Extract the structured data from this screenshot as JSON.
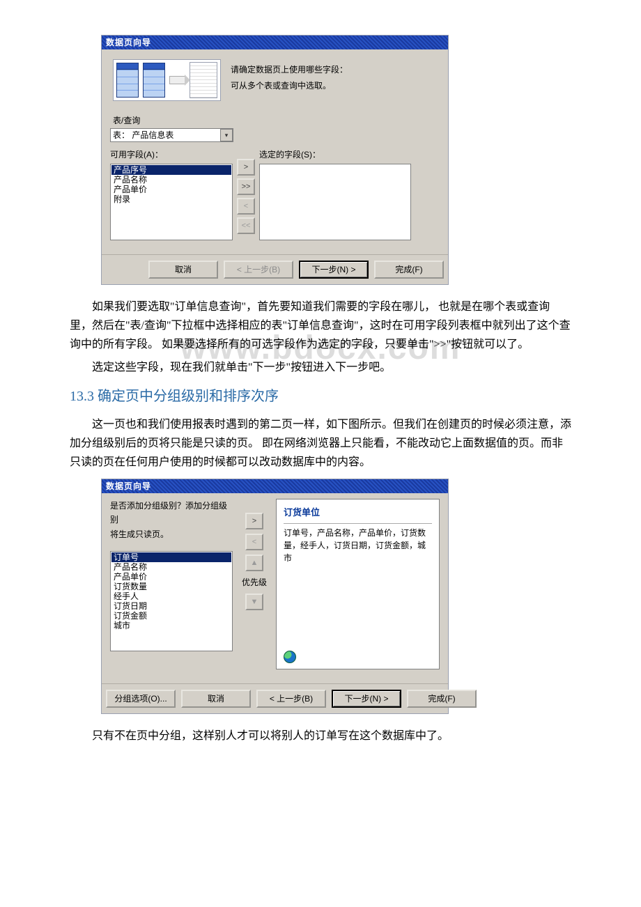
{
  "watermark": "www.bdocx.com",
  "dialog1": {
    "title": "数据页向导",
    "prompt_line1": "请确定数据页上使用哪些字段：",
    "prompt_line2": "可从多个表或查询中选取。",
    "table_query_label": "表/查询",
    "combo_value": "表： 产品信息表",
    "available_label": "可用字段(A)：",
    "selected_label": "选定的字段(S)：",
    "available_items": [
      "产品序号",
      "产品名称",
      "产品单价",
      "附录"
    ],
    "selected_index": 0,
    "btn_move_one": ">",
    "btn_move_all": ">>",
    "btn_back_one": "<",
    "btn_back_all": "<<",
    "cancel": "取消",
    "prev": "< 上一步(B)",
    "next": "下一步(N) >",
    "finish": "完成(F)"
  },
  "para1": "如果我们要选取\"订单信息查询\"，首先要知道我们需要的字段在哪儿， 也就是在哪个表或查询里，然后在\"表/查询\"下拉框中选择相应的表\"订单信息查询\"，这时在可用字段列表框中就列出了这个查询中的所有字段。 如果要选择所有的可选字段作为选定的字段，只要单击\">>\"按钮就可以了。",
  "para2": "选定这些字段，现在我们就单击\"下一步\"按钮进入下一步吧。",
  "section_title": "13.3 确定页中分组级别和排序次序",
  "para3": "这一页也和我们使用报表时遇到的第二页一样，如下图所示。但我们在创建页的时候必须注意，添加分组级别后的页将只能是只读的页。 即在网络浏览器上只能看，不能改动它上面数据值的页。而非只读的页在任何用户使用的时候都可以改动数据库中的内容。",
  "dialog2": {
    "title": "数据页向导",
    "prompt_line1": "是否添加分组级别？添加分组级别",
    "prompt_line2": "将生成只读页。",
    "list_items": [
      "订单号",
      "产品名称",
      "产品单价",
      "订货数量",
      "经手人",
      "订货日期",
      "订货金额",
      "城市"
    ],
    "selected_index": 0,
    "btn_add": ">",
    "btn_remove": "<",
    "priority_label": "优先级",
    "preview_title": "订货单位",
    "preview_body": "订单号，产品名称，产品单价，订货数量，经手人，订货日期，订货金额，城市",
    "group_options": "分组选项(O)...",
    "cancel": "取消",
    "prev": "< 上一步(B)",
    "next": "下一步(N) >",
    "finish": "完成(F)"
  },
  "para4": "只有不在页中分组，这样别人才可以将别人的订单写在这个数据库中了。"
}
